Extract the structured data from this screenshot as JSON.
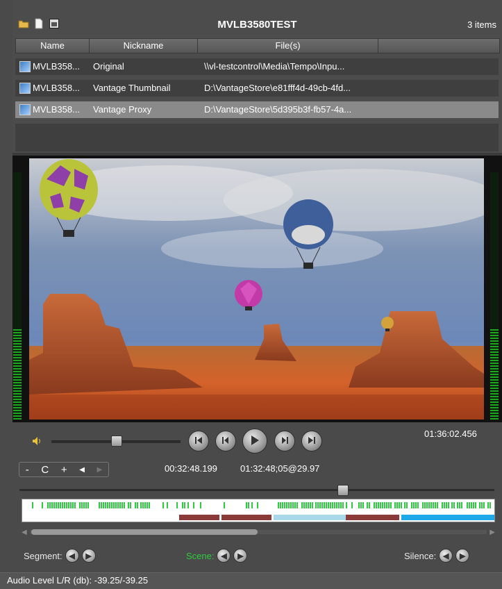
{
  "panel": {
    "title": "MVLB3580TEST",
    "item_count": "3 items",
    "toolbar_icons": [
      "open-folder-icon",
      "document-icon",
      "window-icon"
    ]
  },
  "table": {
    "columns": [
      "Name",
      "Nickname",
      "File(s)"
    ],
    "rows": [
      {
        "name": "MVLB358...",
        "nickname": "Original",
        "file": "\\\\vl-testcontrol\\Media\\Tempo\\Inpu..."
      },
      {
        "name": "MVLB358...",
        "nickname": "Vantage Thumbnail",
        "file": "D:\\VantageStore\\e81fff4d-49cb-4fd..."
      },
      {
        "name": "MVLB358...",
        "nickname": "Vantage Proxy",
        "file": "D:\\VantageStore\\5d395b3f-fb57-4a..."
      }
    ],
    "selected_row": 2
  },
  "player": {
    "duration": "01:36:02.456",
    "current_time": "00:32:48.199",
    "timecode_rate": "01:32:48;05@29.97",
    "volume_level": 0.5,
    "position_level": 0.68,
    "jog": {
      "minus": "-",
      "c": "C",
      "plus": "+",
      "prev": "◀",
      "next": "▶"
    },
    "transport": [
      "skip-start-icon",
      "step-back-icon",
      "play-icon",
      "step-forward-icon",
      "skip-end-icon"
    ]
  },
  "nav": {
    "segment": "Segment:",
    "scene": "Scene:",
    "silence": "Silence:"
  },
  "colors": {
    "scene": "#2ecc40",
    "segment_red": "#8b3a3a",
    "segment_light_blue": "#a8d8ea",
    "segment_blue": "#1fa8e8",
    "meter_green": "#1fa71f"
  },
  "status": {
    "audio_level": "Audio Level L/R (db): -39.25/-39.25"
  }
}
